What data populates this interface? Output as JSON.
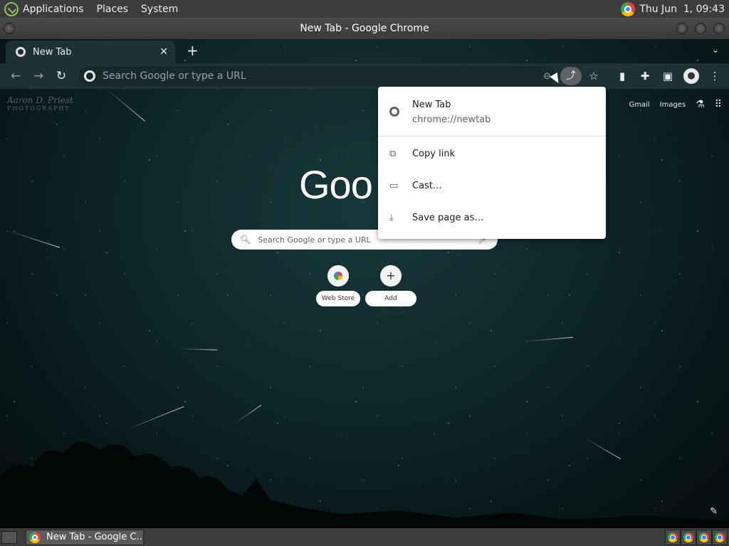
{
  "top_panel": {
    "menus": [
      "Applications",
      "Places",
      "System"
    ],
    "clock": "Thu Jun  1, 09:43"
  },
  "window": {
    "title": "New Tab - Google Chrome"
  },
  "browser": {
    "tab": {
      "title": "New Tab",
      "close": "✕"
    },
    "new_tab": "+",
    "tab_search": "⌄",
    "omnibox": {
      "placeholder": "Search Google or type a URL"
    },
    "ntp": {
      "links": [
        "Gmail",
        "Images"
      ],
      "watermark_line1": "Aaron D. Priest",
      "watermark_line2": "PHOTOGRAPHY",
      "logo_text": "Goo",
      "search_placeholder": "Search Google or type a URL",
      "shortcuts": [
        {
          "label": "Web Store",
          "icon": "web-store-icon"
        },
        {
          "label": "Add shortcut",
          "icon": "plus-icon"
        }
      ]
    },
    "share_menu": {
      "page_title": "New Tab",
      "page_url": "chrome://newtab",
      "items": [
        {
          "label": "Copy link",
          "icon": "copy-icon"
        },
        {
          "label": "Cast…",
          "icon": "cast-icon"
        },
        {
          "label": "Save page as…",
          "icon": "save-icon"
        }
      ]
    }
  },
  "taskbar": {
    "task": "New Tab - Google C..."
  }
}
